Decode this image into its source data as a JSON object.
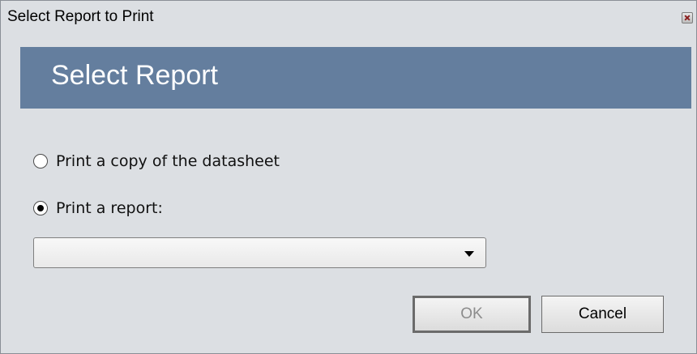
{
  "window": {
    "title": "Select Report to Print"
  },
  "header": {
    "title": "Select Report"
  },
  "options": [
    {
      "label": "Print a copy of the datasheet",
      "checked": false
    },
    {
      "label": "Print a report:",
      "checked": true
    }
  ],
  "report_select": {
    "value": ""
  },
  "buttons": {
    "ok_label": "OK",
    "ok_enabled": false,
    "cancel_label": "Cancel"
  },
  "icons": {
    "close": "close-icon",
    "dropdown": "chevron-down-icon"
  }
}
